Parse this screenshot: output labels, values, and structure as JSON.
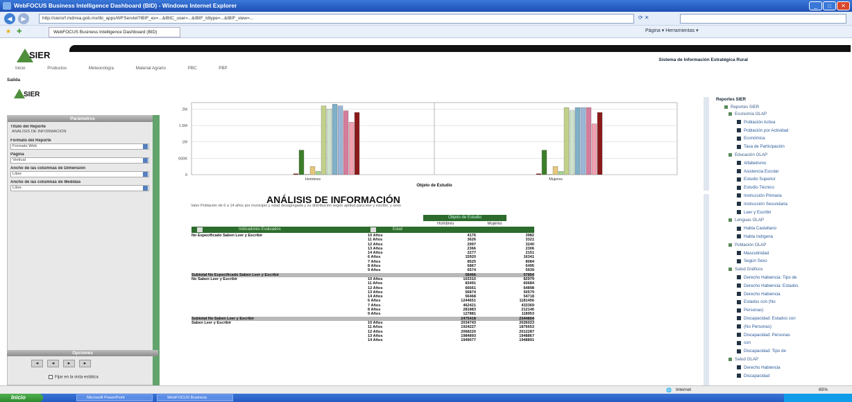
{
  "window": {
    "title": "WebFOCUS Business Intelligence Dashboard (BID) - Windows Internet Explorer"
  },
  "browser": {
    "url": "http://siersrf.mdrrea.gob.mx/ibi_apps/WFServlet?IBIF_ex=...&IBIC_user=...&IBIF_tdtype=...&IBIF_view=...",
    "tab_title": "WebFOCUS Business Intelligence Dashboard (BID)",
    "tools": "Página ▾   Herramientas ▾"
  },
  "header": {
    "logo": "SIER",
    "system_title": "Sistema de Información Estratégica Rural",
    "menu": [
      "Inicio",
      "Productos",
      "Meteorología",
      "Material Agrario",
      "PBC",
      "PBP"
    ],
    "salida": "Salida"
  },
  "left": {
    "panel_title": "Parámetros",
    "fields": [
      {
        "label": "Título del Reporte",
        "value": "ANÁLISIS DE INFORMACIÓN"
      },
      {
        "label": "Formato del Reporte",
        "value": "Formato Web"
      },
      {
        "label": "Página",
        "value": "Vertical"
      },
      {
        "label": "Ancho de las columnas de Dimensión",
        "value": "Libre"
      },
      {
        "label": "Ancho de las columnas de Medidas",
        "value": "Libre"
      }
    ],
    "options_title": "Opciones",
    "checkbox_label": "Fijar en la vista estática"
  },
  "chart_data": {
    "type": "bar",
    "xlabel": "Objeto de Estudio",
    "y_ticks": [
      "2M",
      "1.5M",
      "1M",
      "500K",
      "0"
    ],
    "groups": [
      "Hombres",
      "Mujeres"
    ],
    "colors": [
      "#8b1a1a",
      "#3e7e2a",
      "#b8cc58",
      "#e5c87a",
      "#a6d590",
      "#c2d18a",
      "#cde2cc",
      "#7fb0c8",
      "#9ab6d8",
      "#d67c9c",
      "#f0a0b0"
    ],
    "series_values": {
      "Hombres": [
        0.03,
        0.75,
        0.01,
        0.25,
        0.1,
        2.1,
        2.0,
        2.15,
        2.1,
        1.95,
        1.6,
        1.9
      ],
      "Mujeres": [
        0.03,
        0.75,
        0.01,
        0.25,
        0.1,
        2.05,
        1.95,
        2.05,
        2.05,
        2.05,
        1.55,
        1.9
      ]
    }
  },
  "report": {
    "title": "ANÁLISIS DE INFORMACIÓN",
    "subtitle": "Valor Población de 6 a 14 años por municipio y edad desagregada y su distribución según aptitud para leer y escribir, y sexo",
    "object_header": "Objeto de Estudio",
    "col_hombres": "Hombres",
    "col_mujeres": "Mujeres",
    "col_indicadores": "Indicadores Evaluados",
    "col_edad": "Edad",
    "rows": [
      {
        "g": "No Especificado Saben Leer y Escribir",
        "a": "10 Años",
        "h": "4176",
        "m": "3982"
      },
      {
        "g": "",
        "a": "11 Años",
        "h": "3626",
        "m": "3321"
      },
      {
        "g": "",
        "a": "12 Años",
        "h": "2997",
        "m": "3240"
      },
      {
        "g": "",
        "a": "13 Años",
        "h": "2366",
        "m": "2306"
      },
      {
        "g": "",
        "a": "14 Años",
        "h": "2277",
        "m": "2151"
      },
      {
        "g": "",
        "a": "6 Años",
        "h": "15920",
        "m": "16341"
      },
      {
        "g": "",
        "a": "7 Años",
        "h": "8525",
        "m": "8084"
      },
      {
        "g": "",
        "a": "8 Años",
        "h": "6867",
        "m": "6495"
      },
      {
        "g": "",
        "a": "9 Años",
        "h": "6574",
        "m": "5939"
      },
      {
        "g": "Subtotal No Especificado Saben Leer y Escribir",
        "a": "",
        "h": "58466",
        "m": "57854",
        "grey": true
      },
      {
        "g": "No Saben Leer y Escribir",
        "a": "10 Años",
        "h": "103310",
        "m": "82979"
      },
      {
        "g": "",
        "a": "11 Años",
        "h": "83491",
        "m": "60684"
      },
      {
        "g": "",
        "a": "12 Años",
        "h": "66661",
        "m": "64898"
      },
      {
        "g": "",
        "a": "13 Años",
        "h": "56874",
        "m": "50579"
      },
      {
        "g": "",
        "a": "14 Años",
        "h": "56468",
        "m": "54718"
      },
      {
        "g": "",
        "a": "6 Años",
        "h": "1244651",
        "m": "1181456"
      },
      {
        "g": "",
        "a": "7 Años",
        "h": "462421",
        "m": "433369"
      },
      {
        "g": "",
        "a": "8 Años",
        "h": "281883",
        "m": "212146"
      },
      {
        "g": "",
        "a": "9 Años",
        "h": "127881",
        "m": "118953"
      },
      {
        "g": "Subtotal No Saben Leer y Escribir",
        "a": "",
        "h": "2475418",
        "m": "2344804",
        "grey": true
      },
      {
        "g": "Saben Leer y Escribir",
        "a": "10 Años",
        "h": "2034743",
        "m": "2026023"
      },
      {
        "g": "",
        "a": "11 Años",
        "h": "1924227",
        "m": "1876653"
      },
      {
        "g": "",
        "a": "12 Años",
        "h": "2068220",
        "m": "2012287"
      },
      {
        "g": "",
        "a": "13 Años",
        "h": "1984893",
        "m": "1948867"
      },
      {
        "g": "",
        "a": "14 Años",
        "h": "1949077",
        "m": "1948891"
      }
    ]
  },
  "right": {
    "header": "Reportes SIER",
    "root": "Reportes SIER",
    "items": [
      {
        "t": "Economía OLAP",
        "group": true
      },
      {
        "t": "Población Activa"
      },
      {
        "t": "Población por Actividad"
      },
      {
        "t": "Económica"
      },
      {
        "t": "Tasa de Participación"
      },
      {
        "t": "Educación OLAP",
        "group": true
      },
      {
        "t": "Alfabetismo"
      },
      {
        "t": "Asistencia Escolar"
      },
      {
        "t": "Estudio Superior"
      },
      {
        "t": "Estudio Técnico"
      },
      {
        "t": "Instrucción Primaria"
      },
      {
        "t": "Instrucción Secundaria"
      },
      {
        "t": "Leer y Escribir"
      },
      {
        "t": "Lenguas OLAP",
        "group": true
      },
      {
        "t": "Habla Castellano"
      },
      {
        "t": "Habla Indígena"
      },
      {
        "t": "Población OLAP",
        "group": true
      },
      {
        "t": "Masculinidad"
      },
      {
        "t": "Según Sexo"
      },
      {
        "t": "Salud Gráficos",
        "group": true
      },
      {
        "t": "Derecho Habiencia: Tipo de"
      },
      {
        "t": "Derecho Habiencia: Estados"
      },
      {
        "t": "Derecho Habiencia"
      },
      {
        "t": "Estados con (No"
      },
      {
        "t": "Personas)"
      },
      {
        "t": "Discapacidad: Estados con"
      },
      {
        "t": "(No Personas)"
      },
      {
        "t": "Discapacidad: Personas"
      },
      {
        "t": "con"
      },
      {
        "t": "Discapacidad: Tipo de"
      },
      {
        "t": "Salud OLAP",
        "group": true
      },
      {
        "t": "Derecho Habiencia"
      },
      {
        "t": "Discapacidad"
      }
    ]
  },
  "status": {
    "zone": "Internet",
    "zoom": "85%"
  },
  "taskbar": {
    "start": "Inicio",
    "tasks": [
      "Microsoft PowerPoint",
      "WebFOCUS Business"
    ]
  }
}
